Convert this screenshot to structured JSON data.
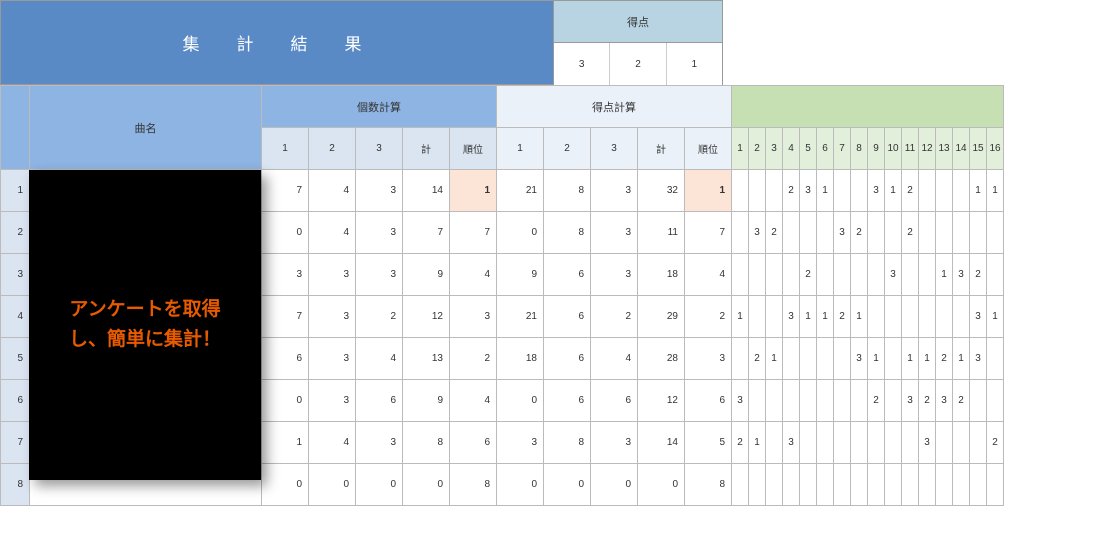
{
  "title": "集　計　結　果",
  "score_header": "得点",
  "score_values": [
    "3",
    "2",
    "1"
  ],
  "group_headers": {
    "count_calc": "個数計算",
    "score_calc": "得点計算"
  },
  "col_headers": {
    "name": "曲名",
    "c1": "1",
    "c2": "2",
    "c3": "3",
    "total": "計",
    "rank": "順位",
    "sc1": "1",
    "sc2": "2",
    "sc3": "3",
    "stotal": "計",
    "srank": "順位"
  },
  "small_cols": [
    "1",
    "2",
    "3",
    "4",
    "5",
    "6",
    "7",
    "8",
    "9",
    "10",
    "11",
    "12",
    "13",
    "14",
    "15",
    "16"
  ],
  "rows": [
    {
      "n": "1",
      "c": [
        "7",
        "4",
        "3",
        "14",
        "1"
      ],
      "cr_hi": true,
      "s": [
        "21",
        "8",
        "3",
        "32",
        "1"
      ],
      "sr_hi": true,
      "sm": [
        "",
        "",
        "",
        "2",
        "3",
        "1",
        "",
        "",
        "3",
        "1",
        "2",
        "",
        "",
        "",
        "1",
        "1"
      ]
    },
    {
      "n": "2",
      "c": [
        "0",
        "4",
        "3",
        "7",
        "7"
      ],
      "s": [
        "0",
        "8",
        "3",
        "11",
        "7"
      ],
      "sm": [
        "",
        "3",
        "2",
        "",
        "",
        "",
        "3",
        "2",
        "",
        "",
        "2",
        "",
        "",
        "",
        "",
        ""
      ]
    },
    {
      "n": "3",
      "c": [
        "3",
        "3",
        "3",
        "9",
        "4"
      ],
      "s": [
        "9",
        "6",
        "3",
        "18",
        "4"
      ],
      "sm": [
        "",
        "",
        "",
        "",
        "2",
        "",
        "",
        "",
        "",
        "3",
        "",
        "",
        "1",
        "3",
        "2",
        ""
      ]
    },
    {
      "n": "4",
      "c": [
        "7",
        "3",
        "2",
        "12",
        "3"
      ],
      "s": [
        "21",
        "6",
        "2",
        "29",
        "2"
      ],
      "sm": [
        "1",
        "",
        "",
        "3",
        "1",
        "1",
        "2",
        "1",
        "",
        "",
        "",
        "",
        "",
        "",
        "3",
        "1"
      ]
    },
    {
      "n": "5",
      "c": [
        "6",
        "3",
        "4",
        "13",
        "2"
      ],
      "s": [
        "18",
        "6",
        "4",
        "28",
        "3"
      ],
      "sm": [
        "",
        "2",
        "1",
        "",
        "",
        "",
        "",
        "3",
        "1",
        "",
        "1",
        "1",
        "2",
        "1",
        "3",
        ""
      ]
    },
    {
      "n": "6",
      "c": [
        "0",
        "3",
        "6",
        "9",
        "4"
      ],
      "s": [
        "0",
        "6",
        "6",
        "12",
        "6"
      ],
      "sm": [
        "3",
        "",
        "",
        "",
        "",
        "",
        "",
        "",
        "2",
        "",
        "3",
        "2",
        "3",
        "2",
        "",
        ""
      ]
    },
    {
      "n": "7",
      "c": [
        "1",
        "4",
        "3",
        "8",
        "6"
      ],
      "s": [
        "3",
        "8",
        "3",
        "14",
        "5"
      ],
      "sm": [
        "2",
        "1",
        "",
        "3",
        "",
        "",
        "",
        "",
        "",
        "",
        "",
        "3",
        "",
        "",
        "",
        "2"
      ]
    },
    {
      "n": "8",
      "c": [
        "0",
        "0",
        "0",
        "0",
        "8"
      ],
      "s": [
        "0",
        "0",
        "0",
        "0",
        "8"
      ],
      "sm": [
        "",
        "",
        "",
        "",
        "",
        "",
        "",
        "",
        "",
        "",
        "",
        "",
        "",
        "",
        "",
        ""
      ]
    }
  ],
  "overlay_text_line1": "アンケートを取得",
  "overlay_text_line2": "し、簡単に集計！"
}
